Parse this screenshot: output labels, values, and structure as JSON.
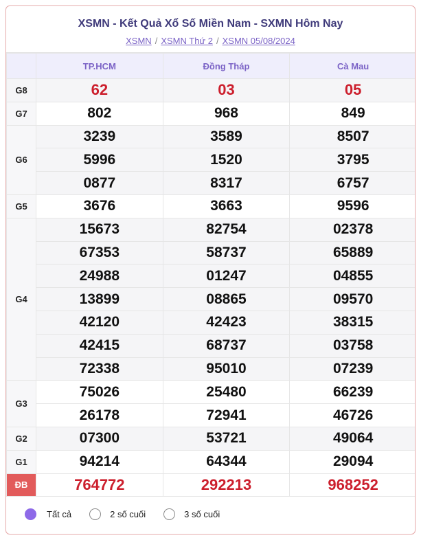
{
  "header": {
    "title": "XSMN - Kết Quả Xổ Số Miền Nam - SXMN Hôm Nay",
    "breadcrumbs": [
      "XSMN",
      "XSMN Thứ 2",
      "XSMN 05/08/2024"
    ]
  },
  "provinces": [
    "TP.HCM",
    "Đồng Tháp",
    "Cà Mau"
  ],
  "prizes": [
    {
      "label": "G8",
      "rows": [
        [
          "62",
          "03",
          "05"
        ]
      ],
      "highlight": true
    },
    {
      "label": "G7",
      "rows": [
        [
          "802",
          "968",
          "849"
        ]
      ]
    },
    {
      "label": "G6",
      "rows": [
        [
          "3239",
          "3589",
          "8507"
        ],
        [
          "5996",
          "1520",
          "3795"
        ],
        [
          "0877",
          "8317",
          "6757"
        ]
      ]
    },
    {
      "label": "G5",
      "rows": [
        [
          "3676",
          "3663",
          "9596"
        ]
      ]
    },
    {
      "label": "G4",
      "rows": [
        [
          "15673",
          "82754",
          "02378"
        ],
        [
          "67353",
          "58737",
          "65889"
        ],
        [
          "24988",
          "01247",
          "04855"
        ],
        [
          "13899",
          "08865",
          "09570"
        ],
        [
          "42120",
          "42423",
          "38315"
        ],
        [
          "42415",
          "68737",
          "03758"
        ],
        [
          "72338",
          "95010",
          "07239"
        ]
      ]
    },
    {
      "label": "G3",
      "rows": [
        [
          "75026",
          "25480",
          "66239"
        ],
        [
          "26178",
          "72941",
          "46726"
        ]
      ]
    },
    {
      "label": "G2",
      "rows": [
        [
          "07300",
          "53721",
          "49064"
        ]
      ]
    },
    {
      "label": "G1",
      "rows": [
        [
          "94214",
          "64344",
          "29094"
        ]
      ]
    },
    {
      "label": "ĐB",
      "rows": [
        [
          "764772",
          "292213",
          "968252"
        ]
      ],
      "highlight": true,
      "special": true
    }
  ],
  "filters": [
    {
      "label": "Tất cả",
      "selected": true
    },
    {
      "label": "2 số cuối",
      "selected": false
    },
    {
      "label": "3 số cuối",
      "selected": false
    }
  ],
  "colors": {
    "accent": "#7b63c6",
    "prize_red": "#cc1f2d",
    "special_bg": "#e25b5b",
    "radio_on": "#8e6ae8"
  }
}
